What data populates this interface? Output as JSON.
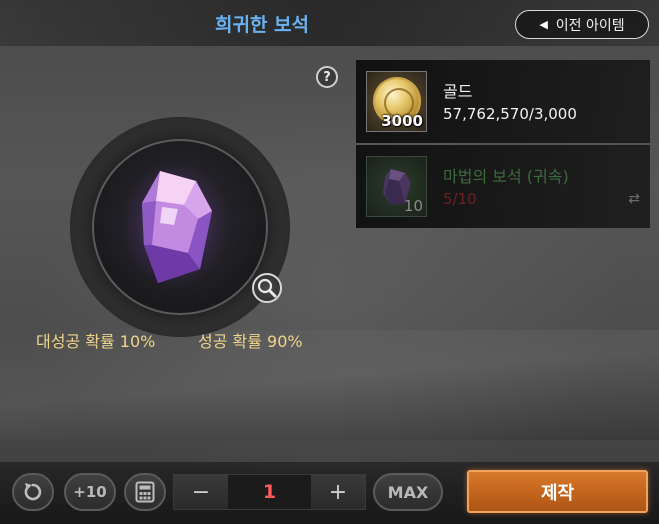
{
  "header": {
    "title": "희귀한 보석",
    "back_button_label": "이전 아이템"
  },
  "preview": {
    "help_label": "?",
    "great_success_rate": "대성공 확률 10%",
    "success_rate": "성공 확률 90%"
  },
  "materials": [
    {
      "name": "골드",
      "amount": "57,762,570/3,000",
      "slot_count": "3000",
      "icon": "gold-coin-icon",
      "sufficient": true
    },
    {
      "name": "마법의 보석 (귀속)",
      "amount": "5/10",
      "slot_count": "10",
      "icon": "magic-gem-icon",
      "sufficient": false,
      "swap_icon": "⇄"
    }
  ],
  "controls": {
    "plus10_label": "+10",
    "minus_label": "−",
    "quantity": "1",
    "plus_label": "+",
    "max_label": "MAX",
    "craft_label": "제작"
  },
  "colors": {
    "title": "#6ab3f2",
    "rate_text": "#efd58a",
    "quantity": "#ff5b5b",
    "craft_button": "#c4651d",
    "insufficient": "#6e1f1f"
  }
}
